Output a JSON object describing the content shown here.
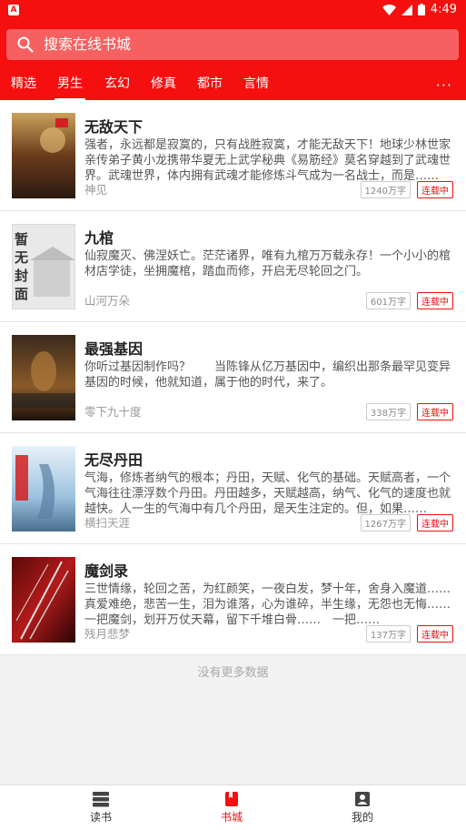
{
  "status_bar": {
    "notification_letter": "A",
    "time": "4:49"
  },
  "search": {
    "placeholder": "搜索在线书城"
  },
  "tabs": [
    {
      "label": "精选"
    },
    {
      "label": "男生"
    },
    {
      "label": "玄幻"
    },
    {
      "label": "修真"
    },
    {
      "label": "都市"
    },
    {
      "label": "言情"
    }
  ],
  "tabs_more": "···",
  "books": [
    {
      "title": "无敌天下",
      "desc": "强者，永远都是寂寞的，只有战胜寂寞，才能无敌天下！地球少林世家亲传弟子黄小龙携带华夏无上武学秘典《易筋经》莫名穿越到了武魂世界。武魂世界，体内拥有武魂才能修炼斗气成为一名战士，而是……",
      "author": "神见",
      "words": "1240万字",
      "status": "连载中",
      "cover_text": "无敌天下"
    },
    {
      "title": "九棺",
      "desc": "仙寂魔灭、佛涅妖亡。茫茫诸界，唯有九棺万万载永存！一个小小的棺材店学徒，坐拥魔棺，踏血而修，开启无尽轮回之门。",
      "author": "山河万朵",
      "words": "601万字",
      "status": "连载中",
      "cover_text": "暂无封面"
    },
    {
      "title": "最强基因",
      "desc": "你听过基因制作吗？　　当陈锋从亿万基因中，编织出那条最罕见变异基因的时候，他就知道，属于他的时代，来了。",
      "author": "零下九十度",
      "words": "338万字",
      "status": "连载中",
      "cover_text": "最强基因"
    },
    {
      "title": "无尽丹田",
      "desc": "气海，修炼者纳气的根本；丹田，天赋、化气的基础。天赋高者，一个气海往往漂浮数个丹田。丹田越多，天赋越高，纳气、化气的速度也就越快。人一生的气海中有几个丹田，是天生注定的。但，如果……",
      "author": "横扫天涯",
      "words": "1267万字",
      "status": "连载中",
      "cover_text": "无尽丹田"
    },
    {
      "title": "魔剑录",
      "desc": "三世情缘，轮回之苦，为红颜笑，一夜白发，梦十年，舍身入魔道……　真爱难绝，悲苦一生，泪为谁落，心为谁碎，半生缘，无怨也无悔……　一把魔剑，划开万仗天幕，留下千堆白骨……　一把……",
      "author": "残月悲梦",
      "words": "137万字",
      "status": "连载中",
      "cover_text": "魔剑录"
    }
  ],
  "no_more": "没有更多数据",
  "bottom_nav": [
    {
      "label": "读书",
      "icon": "bookshelf-icon"
    },
    {
      "label": "书城",
      "icon": "bookstore-icon"
    },
    {
      "label": "我的",
      "icon": "profile-icon"
    }
  ],
  "colors": {
    "primary": "#f50f0f",
    "search_bg": "#f76060"
  }
}
